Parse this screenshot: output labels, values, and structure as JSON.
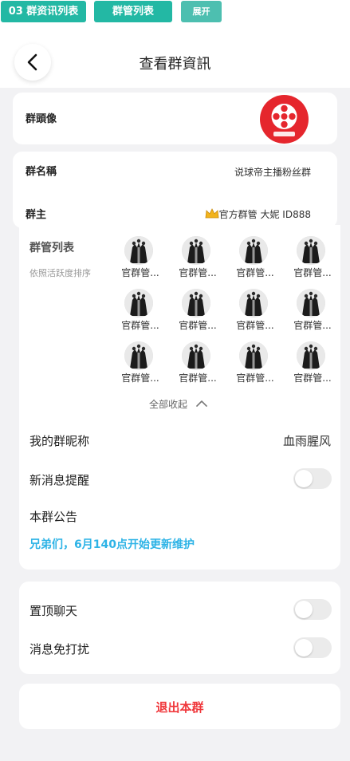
{
  "tabs": [
    {
      "label": "03 群资讯列表"
    },
    {
      "label": "群管列表"
    },
    {
      "label": "展开"
    }
  ],
  "header": {
    "title": "查看群資訊"
  },
  "group": {
    "avatar_label": "群頭像",
    "name_label": "群名稱",
    "name_value": "说球帝主播粉丝群",
    "owner_label": "群主",
    "owner_value": "官方群管 大妮 ID888",
    "owner_badge_icon": "crown-icon"
  },
  "admins": {
    "title": "群管列表",
    "subtitle": "依照活跃度排序",
    "items": [
      {
        "name": "官群管..."
      },
      {
        "name": "官群管..."
      },
      {
        "name": "官群管..."
      },
      {
        "name": "官群管..."
      },
      {
        "name": "官群管..."
      },
      {
        "name": "官群管..."
      },
      {
        "name": "官群管..."
      },
      {
        "name": "官群管..."
      },
      {
        "name": "官群管..."
      },
      {
        "name": "官群管..."
      },
      {
        "name": "官群管..."
      },
      {
        "name": "官群管..."
      }
    ],
    "collapse_label": "全部收起"
  },
  "settings": {
    "nickname_label": "我的群昵称",
    "nickname_value": "血雨腥风",
    "notify_label": "新消息提醒",
    "notify_on": false,
    "announcement_label": "本群公告",
    "announcement_text": "兄弟们，6月140点开始更新维护",
    "pin_label": "置顶聊天",
    "pin_on": false,
    "mute_label": "消息免打扰",
    "mute_on": false
  },
  "actions": {
    "leave_label": "退出本群"
  },
  "colors": {
    "accent": "#23b8a4",
    "link": "#2db3e6",
    "danger": "#f0373b"
  }
}
